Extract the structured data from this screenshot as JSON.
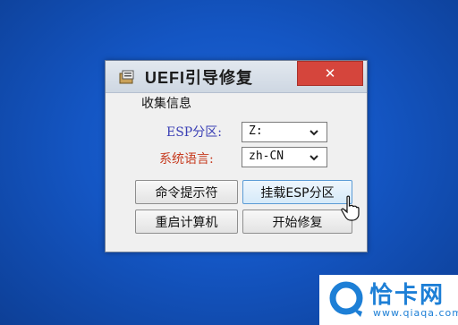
{
  "window": {
    "title": "UEFI引导修复",
    "close_label": "✕"
  },
  "form": {
    "group_label": "收集信息",
    "esp_label": "ESP分区:",
    "esp_value": "Z:",
    "lang_label": "系统语言:",
    "lang_value": "zh-CN"
  },
  "buttons": {
    "cmd": "命令提示符",
    "mount": "挂载ESP分区",
    "reboot": "重启计算机",
    "repair": "开始修复"
  },
  "watermark": {
    "name": "恰卡网",
    "url": "www.qiaqa.com"
  },
  "colors": {
    "desktop": "#1456c4",
    "close_button": "#d5453c",
    "esp_label": "#3a3fb5",
    "lang_label": "#c63a1e",
    "watermark_text": "#1d7fd6"
  }
}
